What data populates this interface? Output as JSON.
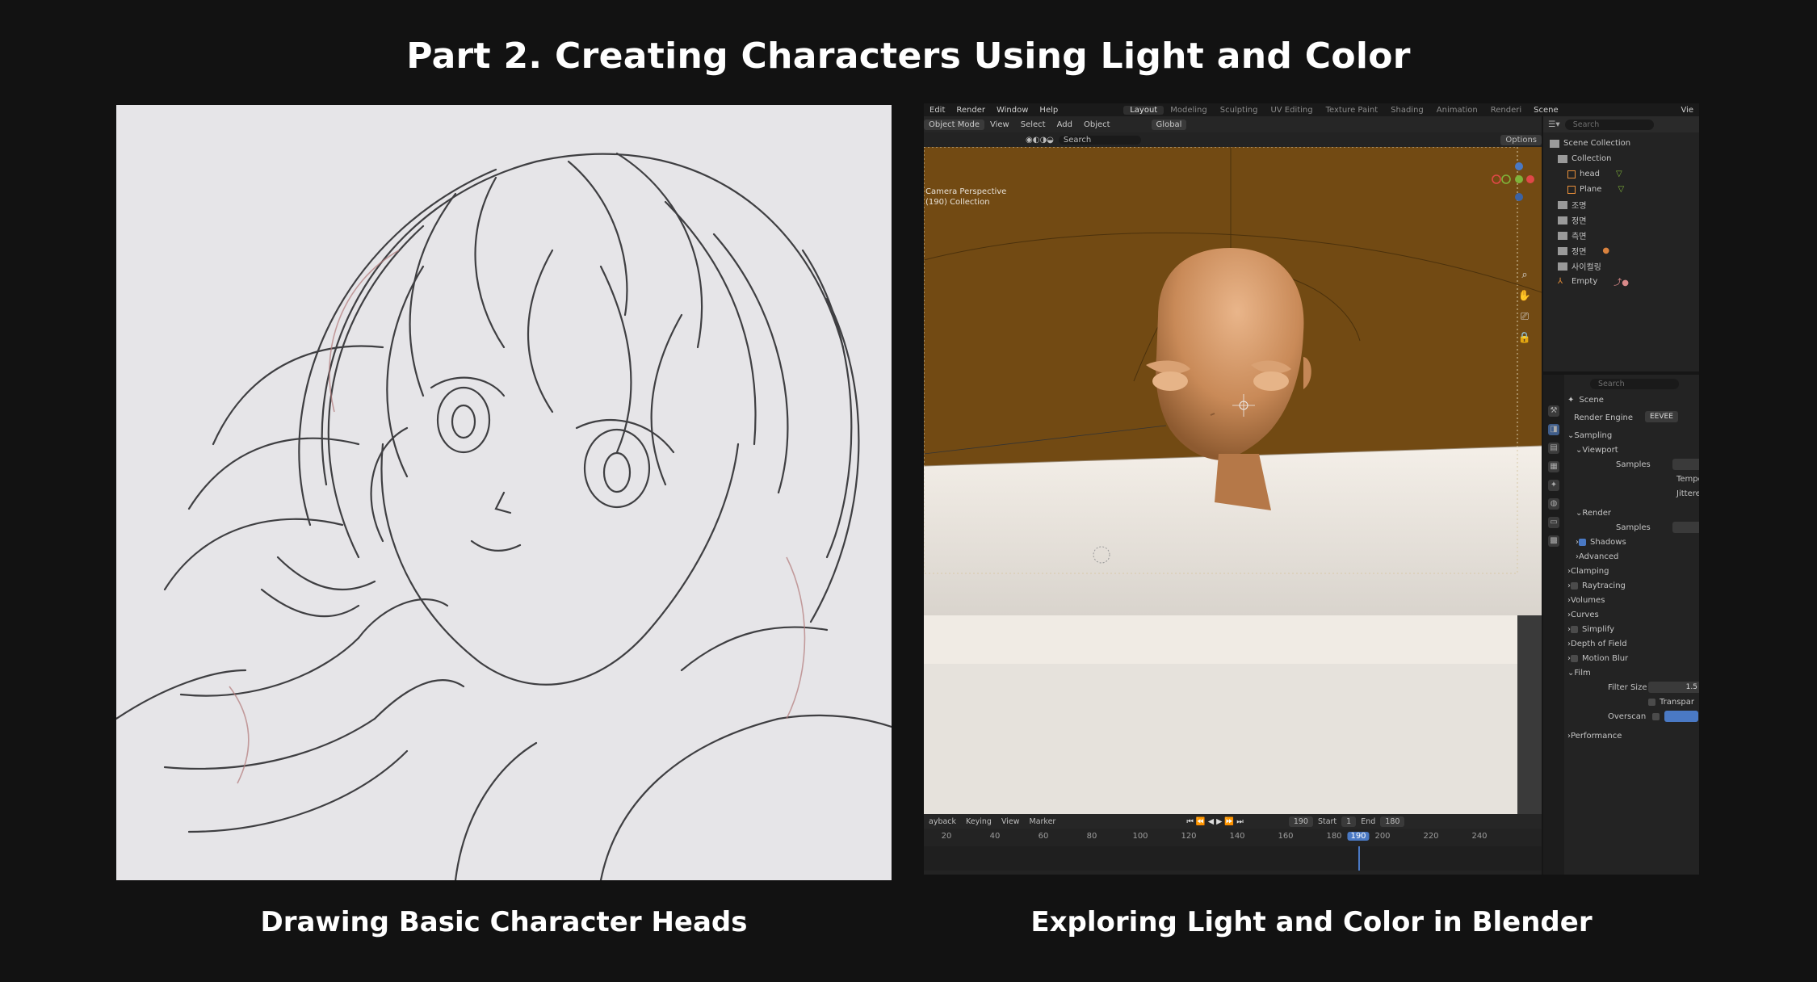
{
  "title": "Part 2. Creating Characters Using Light and Color",
  "captions": {
    "left": "Drawing Basic Character Heads",
    "right": "Exploring Light and Color in Blender"
  },
  "blender": {
    "menu": [
      "Edit",
      "Render",
      "Window",
      "Help"
    ],
    "workspaces": [
      "Layout",
      "Modeling",
      "Sculpting",
      "UV Editing",
      "Texture Paint",
      "Shading",
      "Animation",
      "Renderi"
    ],
    "active_workspace": "Layout",
    "scene_label": "Scene",
    "view_layer_label": "Vie",
    "header": {
      "mode": "Object Mode",
      "view": "View",
      "select": "Select",
      "add": "Add",
      "object": "Object",
      "transform": "Global",
      "search_placeholder": "Search",
      "options": "Options"
    },
    "viewport": {
      "camera_label": "Camera Perspective",
      "collection_label": "(190) Collection"
    },
    "outliner": {
      "search_placeholder": "Search",
      "items": [
        {
          "label": "Scene Collection"
        },
        {
          "label": "Collection"
        },
        {
          "label": "head"
        },
        {
          "label": "Plane"
        },
        {
          "label": "조명"
        },
        {
          "label": "정면"
        },
        {
          "label": "측면"
        },
        {
          "label": "정면"
        },
        {
          "label": "사이컬링"
        },
        {
          "label": "Empty"
        }
      ]
    },
    "properties": {
      "search_placeholder": "Search",
      "scene": "Scene",
      "render_engine_label": "Render Engine",
      "render_engine_value": "EEVEE",
      "sampling": "Sampling",
      "viewport": "Viewport",
      "samples": "Samples",
      "temporal": "Tempo",
      "jittered": "Jittered",
      "render": "Render",
      "render_samples": "Samples",
      "shadows": "Shadows",
      "advanced": "Advanced",
      "clamping": "Clamping",
      "raytracing": "Raytracing",
      "volumes": "Volumes",
      "curves": "Curves",
      "simplify": "Simplify",
      "depth_of_field": "Depth of Field",
      "motion_blur": "Motion Blur",
      "film": "Film",
      "filter_size_label": "Filter Size",
      "filter_size_value": "1.5",
      "transparent": "Transpar",
      "overscan": "Overscan",
      "performance": "Performance"
    },
    "timeline": {
      "playback": "ayback",
      "keying": "Keying",
      "view": "View",
      "marker": "Marker",
      "current_frame": "190",
      "start_label": "Start",
      "start_value": "1",
      "end_label": "End",
      "end_value": "180",
      "ticks": [
        "20",
        "40",
        "60",
        "80",
        "100",
        "120",
        "140",
        "160",
        "180",
        "190",
        "200",
        "220",
        "240"
      ]
    },
    "colors": {
      "wall": "#7a4f14",
      "skin": "#d79a6b",
      "accent": "#4a79c4"
    }
  }
}
